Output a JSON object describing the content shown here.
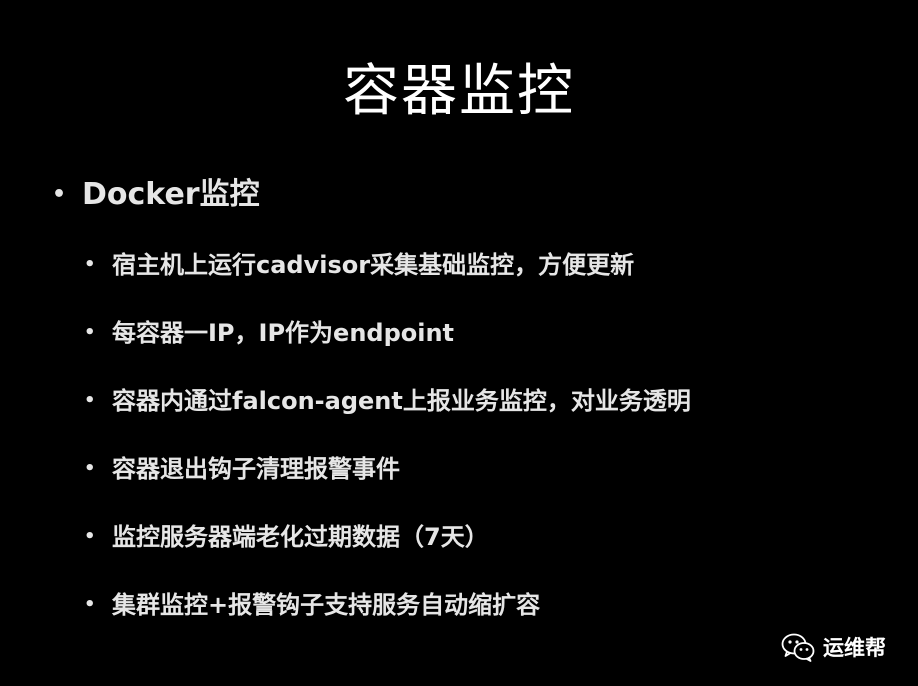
{
  "slide": {
    "title": "容器监控",
    "bullet": "Docker监控",
    "sub_bullets": [
      "宿主机上运行cadvisor采集基础监控，方便更新",
      "每容器一IP，IP作为endpoint",
      "容器内通过falcon-agent上报业务监控，对业务透明",
      "容器退出钩子清理报警事件",
      "监控服务器端老化过期数据（7天）",
      "集群监控+报警钩子支持服务自动缩扩容"
    ]
  },
  "watermark": {
    "icon": "wechat-icon",
    "label": "运维帮"
  },
  "colors": {
    "background": "#000000",
    "text": "#ffffff"
  }
}
